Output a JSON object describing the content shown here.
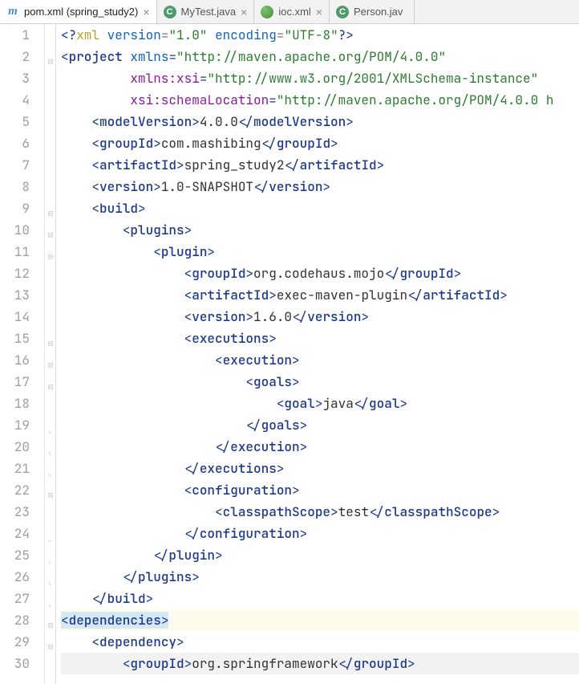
{
  "tabs": [
    {
      "label": "pom.xml (spring_study2)",
      "icon": "m",
      "active": true
    },
    {
      "label": "MyTest.java",
      "icon": "c",
      "active": false
    },
    {
      "label": "ioc.xml",
      "icon": "spring",
      "active": false
    },
    {
      "label": "Person.jav",
      "icon": "c",
      "active": false,
      "truncated": true
    }
  ],
  "lines": {
    "start": 1,
    "end": 30
  },
  "code": {
    "l1": {
      "pi_open": "<?",
      "pi_name": "xml",
      "attr1": "version",
      "val1": "\"1.0\"",
      "attr2": "encoding",
      "val2": "\"UTF-8\"",
      "pi_close": "?>"
    },
    "l2": {
      "open": "<",
      "tag": "project",
      "attr": "xmlns",
      "eq": "=",
      "val": "\"http://maven.apache.org/POM/4.0.0\""
    },
    "l3": {
      "ns": "xmlns:xsi",
      "eq": "=",
      "val": "\"http://www.w3.org/2001/XMLSchema-instance\""
    },
    "l4": {
      "ns": "xsi:schemaLocation",
      "eq": "=",
      "val": "\"http://maven.apache.org/POM/4.0.0 h"
    },
    "l5": {
      "open": "<",
      "tag": "modelVersion",
      "close": ">",
      "text": "4.0.0",
      "open2": "</",
      "tag2": "modelVersion",
      "close2": ">"
    },
    "l6": {
      "open": "<",
      "tag": "groupId",
      "close": ">",
      "text": "com.mashibing",
      "open2": "</",
      "tag2": "groupId",
      "close2": ">"
    },
    "l7": {
      "open": "<",
      "tag": "artifactId",
      "close": ">",
      "text": "spring_study2",
      "open2": "</",
      "tag2": "artifactId",
      "close2": ">"
    },
    "l8": {
      "open": "<",
      "tag": "version",
      "close": ">",
      "text": "1.0-SNAPSHOT",
      "open2": "</",
      "tag2": "version",
      "close2": ">"
    },
    "l9": {
      "open": "<",
      "tag": "build",
      "close": ">"
    },
    "l10": {
      "open": "<",
      "tag": "plugins",
      "close": ">"
    },
    "l11": {
      "open": "<",
      "tag": "plugin",
      "close": ">"
    },
    "l12": {
      "open": "<",
      "tag": "groupId",
      "close": ">",
      "text": "org.codehaus.mojo",
      "open2": "</",
      "tag2": "groupId",
      "close2": ">"
    },
    "l13": {
      "open": "<",
      "tag": "artifactId",
      "close": ">",
      "text": "exec-maven-plugin",
      "open2": "</",
      "tag2": "artifactId",
      "close2": ">"
    },
    "l14": {
      "open": "<",
      "tag": "version",
      "close": ">",
      "text": "1.6.0",
      "open2": "</",
      "tag2": "version",
      "close2": ">"
    },
    "l15": {
      "open": "<",
      "tag": "executions",
      "close": ">"
    },
    "l16": {
      "open": "<",
      "tag": "execution",
      "close": ">"
    },
    "l17": {
      "open": "<",
      "tag": "goals",
      "close": ">"
    },
    "l18": {
      "open": "<",
      "tag": "goal",
      "close": ">",
      "text": "java",
      "open2": "</",
      "tag2": "goal",
      "close2": ">"
    },
    "l19": {
      "open": "</",
      "tag": "goals",
      "close": ">"
    },
    "l20": {
      "open": "</",
      "tag": "execution",
      "close": ">"
    },
    "l21": {
      "open": "</",
      "tag": "executions",
      "close": ">"
    },
    "l22": {
      "open": "<",
      "tag": "configuration",
      "close": ">"
    },
    "l23": {
      "open": "<",
      "tag": "classpathScope",
      "close": ">",
      "text": "test",
      "open2": "</",
      "tag2": "classpathScope",
      "close2": ">"
    },
    "l24": {
      "open": "</",
      "tag": "configuration",
      "close": ">"
    },
    "l25": {
      "open": "</",
      "tag": "plugin",
      "close": ">"
    },
    "l26": {
      "open": "</",
      "tag": "plugins",
      "close": ">"
    },
    "l27": {
      "open": "</",
      "tag": "build",
      "close": ">"
    },
    "l28": {
      "open": "<",
      "tag": "dependencies",
      "close": ">"
    },
    "l29": {
      "open": "<",
      "tag": "dependency",
      "close": ">"
    },
    "l30": {
      "open": "<",
      "tag": "groupId",
      "close": ">",
      "text": "org.springframework",
      "open2": "</",
      "tag2": "groupId",
      "close2": ">"
    }
  },
  "watermark": ""
}
